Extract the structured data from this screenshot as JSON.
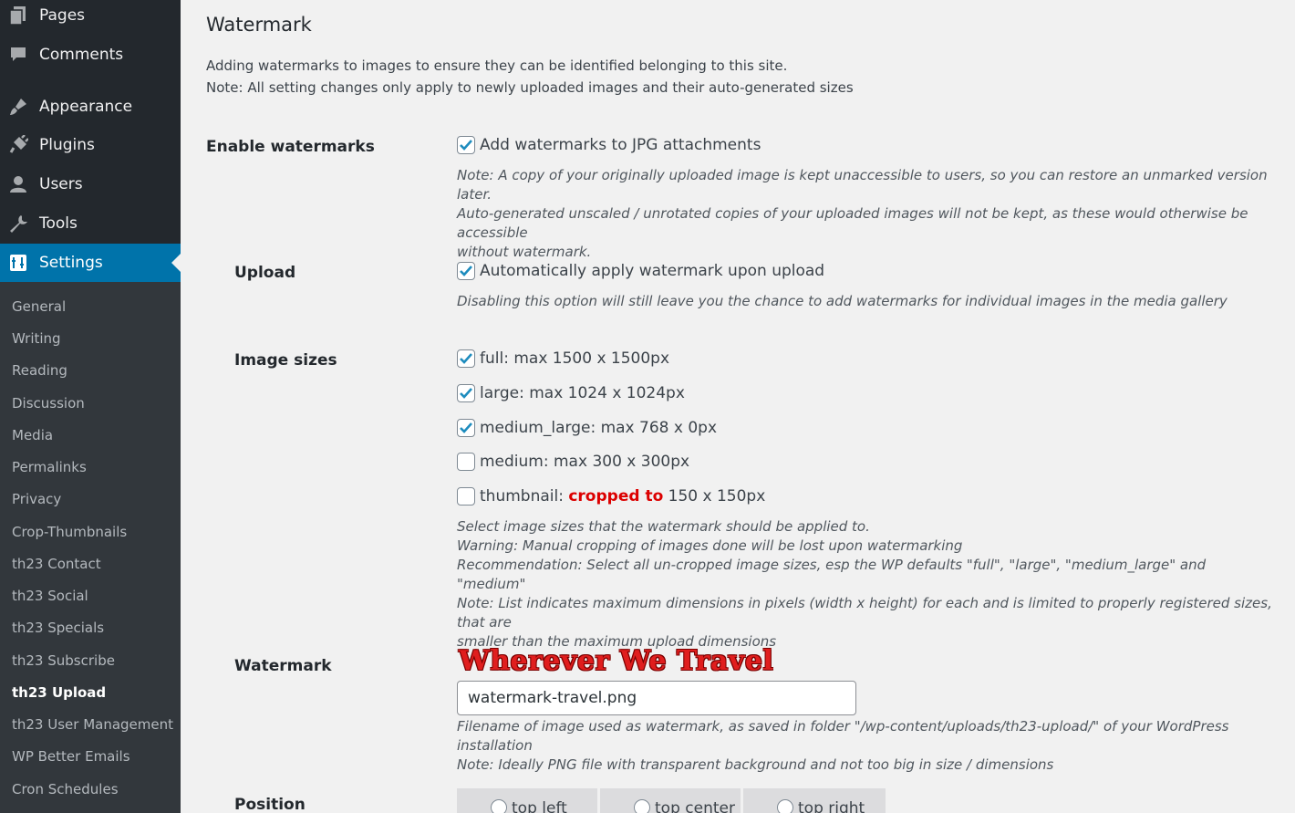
{
  "sidebar": {
    "menu": [
      {
        "label": "Pages",
        "icon": "pages-icon"
      },
      {
        "label": "Comments",
        "icon": "comments-icon"
      },
      {
        "label": "Appearance",
        "icon": "appearance-icon"
      },
      {
        "label": "Plugins",
        "icon": "plugins-icon"
      },
      {
        "label": "Users",
        "icon": "users-icon"
      },
      {
        "label": "Tools",
        "icon": "tools-icon"
      },
      {
        "label": "Settings",
        "icon": "settings-icon"
      }
    ],
    "submenu": [
      "General",
      "Writing",
      "Reading",
      "Discussion",
      "Media",
      "Permalinks",
      "Privacy",
      "Crop-Thumbnails",
      "th23 Contact",
      "th23 Social",
      "th23 Specials",
      "th23 Subscribe",
      "th23 Upload",
      "th23 User Management",
      "WP Better Emails",
      "Cron Schedules"
    ],
    "active_color": "#0073aa"
  },
  "page": {
    "title": "Watermark",
    "intro_1": "Adding watermarks to images to ensure they can be identified belonging to this site.",
    "intro_2": "Note: All setting changes only apply to newly uploaded images and their auto-generated sizes"
  },
  "enable": {
    "label": "Enable watermarks",
    "option": "Add watermarks to JPG attachments",
    "checked": true,
    "desc_1": "Note: A copy of your originally uploaded image is kept unaccessible to users, so you can restore an unmarked version later.",
    "desc_2": "Auto-generated unscaled / unrotated copies of your uploaded images will not be kept, as these would otherwise be accessible",
    "desc_3": "without watermark."
  },
  "upload": {
    "label": "Upload",
    "option": "Automatically apply watermark upon upload",
    "checked": true,
    "desc": "Disabling this option will still leave you the chance to add watermarks for individual images in the media gallery"
  },
  "sizes": {
    "label": "Image sizes",
    "items": [
      {
        "label": "full: max 1500 x 1500px",
        "checked": true
      },
      {
        "label": "large: max 1024 x 1024px",
        "checked": true
      },
      {
        "label": "medium_large: max 768 x 0px",
        "checked": true
      },
      {
        "label": "medium: max 300 x 300px",
        "checked": false
      }
    ],
    "thumb_prefix": "thumbnail: ",
    "thumb_red": "cropped to",
    "thumb_suffix": " 150 x 150px",
    "thumb_checked": false,
    "desc_1": "Select image sizes that the watermark should be applied to.",
    "desc_2": "Warning: Manual cropping of images done will be lost upon watermarking",
    "desc_3": "Recommendation: Select all un-cropped image sizes, esp the WP defaults \"full\", \"large\", \"medium_large\" and \"medium\"",
    "desc_4": "Note: List indicates maximum dimensions in pixels (width x height) for each and is limited to properly registered sizes, that are",
    "desc_5": "smaller than the maximum upload dimensions"
  },
  "watermark": {
    "label": "Watermark",
    "preview_text": "Wherever We Travel",
    "filename": "watermark-travel.png",
    "desc_1": "Filename of image used as watermark, as saved in folder \"/wp-content/uploads/th23-upload/\" of your WordPress installation",
    "desc_2": "Note: Ideally PNG file with transparent background and not too big in size / dimensions"
  },
  "position": {
    "label": "Position",
    "options": [
      "top left",
      "top center",
      "top right"
    ]
  }
}
